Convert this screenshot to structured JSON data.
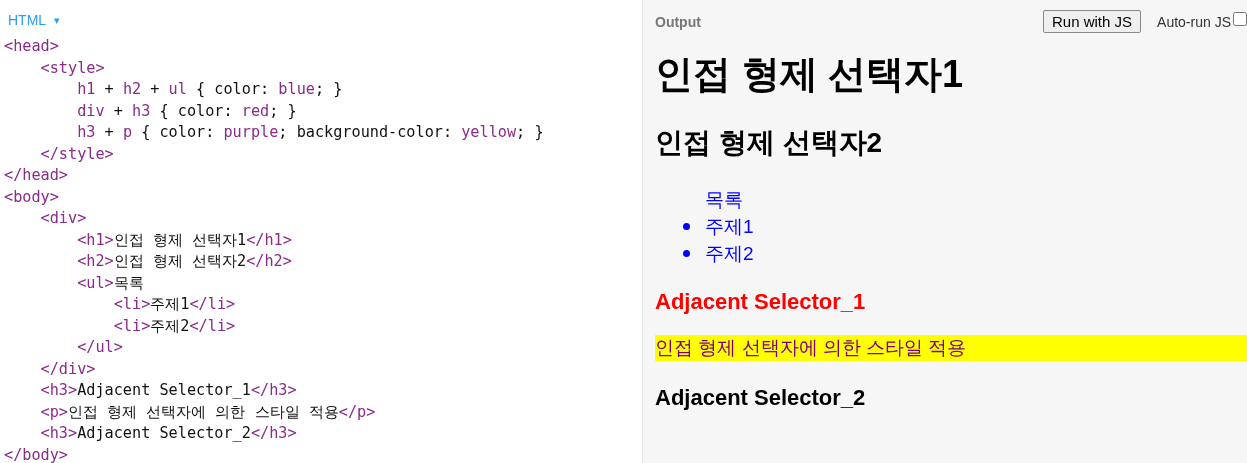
{
  "editor": {
    "language": "HTML",
    "dropdown": "▾",
    "lines": [
      {
        "tokens": [
          {
            "kind": "tag",
            "text": "<head>"
          }
        ]
      },
      {
        "tokens": [
          {
            "kind": "tag",
            "text": "    <style>"
          }
        ]
      },
      {
        "tokens": [
          {
            "kind": "tag",
            "text": "        h1"
          },
          {
            "kind": "plain",
            "text": " + "
          },
          {
            "kind": "tag",
            "text": "h2"
          },
          {
            "kind": "plain",
            "text": " + "
          },
          {
            "kind": "tag",
            "text": "ul"
          },
          {
            "kind": "plain",
            "text": " { color: "
          },
          {
            "kind": "tag",
            "text": "blue"
          },
          {
            "kind": "plain",
            "text": "; }"
          }
        ]
      },
      {
        "tokens": [
          {
            "kind": "tag",
            "text": "        div"
          },
          {
            "kind": "plain",
            "text": " + "
          },
          {
            "kind": "tag",
            "text": "h3"
          },
          {
            "kind": "plain",
            "text": " { color: "
          },
          {
            "kind": "tag",
            "text": "red"
          },
          {
            "kind": "plain",
            "text": "; }"
          }
        ]
      },
      {
        "tokens": [
          {
            "kind": "tag",
            "text": "        h3"
          },
          {
            "kind": "plain",
            "text": " + "
          },
          {
            "kind": "tag",
            "text": "p"
          },
          {
            "kind": "plain",
            "text": " { color: "
          },
          {
            "kind": "tag",
            "text": "purple"
          },
          {
            "kind": "plain",
            "text": "; background-color: "
          },
          {
            "kind": "tag",
            "text": "yellow"
          },
          {
            "kind": "plain",
            "text": "; }"
          }
        ]
      },
      {
        "tokens": [
          {
            "kind": "tag",
            "text": "    </style>"
          }
        ]
      },
      {
        "tokens": [
          {
            "kind": "tag",
            "text": "</head>"
          }
        ]
      },
      {
        "tokens": [
          {
            "kind": "tag",
            "text": "<body>"
          }
        ]
      },
      {
        "tokens": [
          {
            "kind": "tag",
            "text": "    <div>"
          }
        ]
      },
      {
        "tokens": [
          {
            "kind": "tag",
            "text": "        <h1>"
          },
          {
            "kind": "plain",
            "text": "인접 형제 선택자1"
          },
          {
            "kind": "tag",
            "text": "</h1>"
          }
        ]
      },
      {
        "tokens": [
          {
            "kind": "tag",
            "text": "        <h2>"
          },
          {
            "kind": "plain",
            "text": "인접 형제 선택자2"
          },
          {
            "kind": "tag",
            "text": "</h2>"
          }
        ]
      },
      {
        "tokens": [
          {
            "kind": "tag",
            "text": "        <ul>"
          },
          {
            "kind": "plain",
            "text": "목록"
          }
        ]
      },
      {
        "tokens": [
          {
            "kind": "tag",
            "text": "            <li>"
          },
          {
            "kind": "plain",
            "text": "주제1"
          },
          {
            "kind": "tag",
            "text": "</li>"
          }
        ]
      },
      {
        "tokens": [
          {
            "kind": "tag",
            "text": "            <li>"
          },
          {
            "kind": "plain",
            "text": "주제2"
          },
          {
            "kind": "tag",
            "text": "</li>"
          }
        ]
      },
      {
        "tokens": [
          {
            "kind": "tag",
            "text": "        </ul>"
          }
        ]
      },
      {
        "tokens": [
          {
            "kind": "tag",
            "text": "    </div>"
          }
        ]
      },
      {
        "tokens": [
          {
            "kind": "tag",
            "text": "    <h3>"
          },
          {
            "kind": "plain",
            "text": "Adjacent Selector_1"
          },
          {
            "kind": "tag",
            "text": "</h3>"
          }
        ]
      },
      {
        "tokens": [
          {
            "kind": "tag",
            "text": "    <p>"
          },
          {
            "kind": "plain",
            "text": "인접 형제 선택자에 의한 스타일 적용"
          },
          {
            "kind": "tag",
            "text": "</p>"
          }
        ]
      },
      {
        "tokens": [
          {
            "kind": "tag",
            "text": "    <h3>"
          },
          {
            "kind": "plain",
            "text": "Adjacent Selector_2"
          },
          {
            "kind": "tag",
            "text": "</h3>"
          }
        ]
      },
      {
        "tokens": [
          {
            "kind": "tag",
            "text": "</body>"
          }
        ]
      }
    ]
  },
  "output": {
    "title": "Output",
    "run_button": "Run with JS",
    "auto_run": {
      "label": "Auto-run JS",
      "checked": false
    },
    "blocks": [
      {
        "kind": "h1",
        "text": "인접 형제 선택자1"
      },
      {
        "kind": "h2",
        "text": "인접 형제 선택자2"
      },
      {
        "kind": "list",
        "text": "목록",
        "items": [
          "주제1",
          "주제2"
        ]
      },
      {
        "kind": "h3red",
        "text": "Adjacent Selector_1"
      },
      {
        "kind": "highlight",
        "text": "인접 형제 선택자에 의한 스타일 적용"
      },
      {
        "kind": "h3",
        "text": "Adjacent Selector_2"
      }
    ]
  }
}
